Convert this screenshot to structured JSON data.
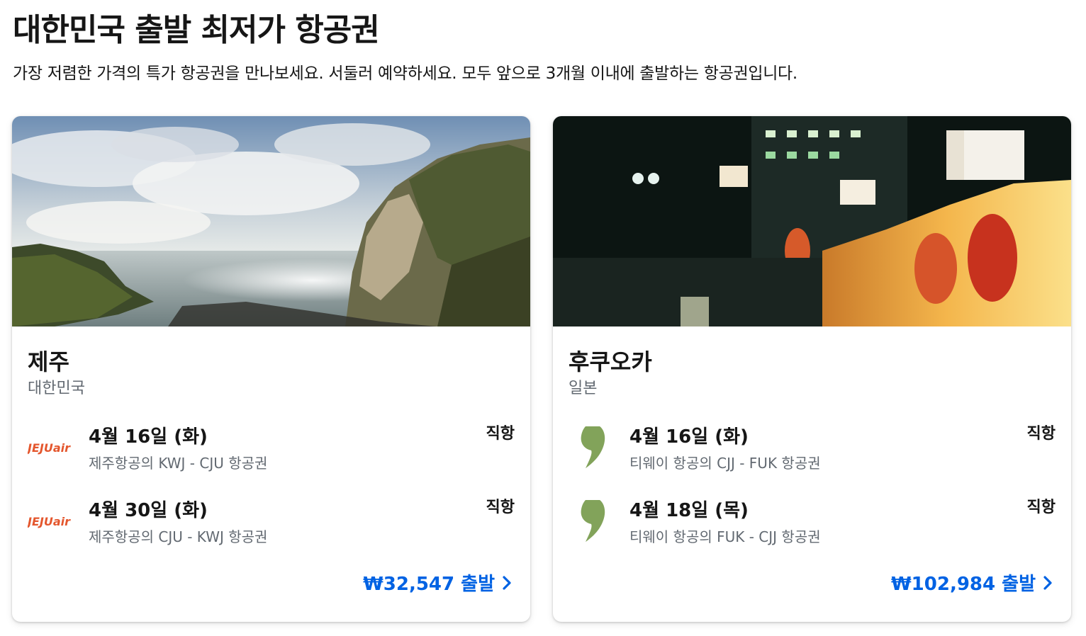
{
  "header": {
    "title": "대한민국 출발 최저가 항공권",
    "subtitle": "가장 저렴한 가격의 특가 항공권을 만나보세요. 서둘러 예약하세요. 모두 앞으로 3개월 이내에 출발하는 항공권입니다."
  },
  "cards": [
    {
      "city": "제주",
      "country": "대한민국",
      "image_icon": "coastal-cliff-photo",
      "flights": [
        {
          "date": "4월 16일 (화)",
          "route": "제주항공의 KWJ - CJU 항공권",
          "type": "직항",
          "logo": "JEJUair",
          "logo_icon": "jejuair-logo-icon"
        },
        {
          "date": "4월 30일 (화)",
          "route": "제주항공의 CJU - KWJ 항공권",
          "type": "직항",
          "logo": "JEJUair",
          "logo_icon": "jejuair-logo-icon"
        }
      ],
      "price_label": "₩32,547 출발"
    },
    {
      "city": "후쿠오카",
      "country": "일본",
      "image_icon": "ramen-street-night-photo",
      "flights": [
        {
          "date": "4월 16일 (화)",
          "route": "티웨이 항공의 CJJ - FUK 항공권",
          "type": "직항",
          "logo_icon": "tway-comma-logo-icon"
        },
        {
          "date": "4월 18일 (목)",
          "route": "티웨이 항공의 FUK - CJJ 항공권",
          "type": "직항",
          "logo_icon": "tway-comma-logo-icon"
        }
      ],
      "price_label": "₩102,984 출발"
    }
  ],
  "colors": {
    "price": "#0062e3",
    "secondary_text": "#626971",
    "jejuair_logo": "#e4572e",
    "tway_logo": "#82a35a"
  }
}
